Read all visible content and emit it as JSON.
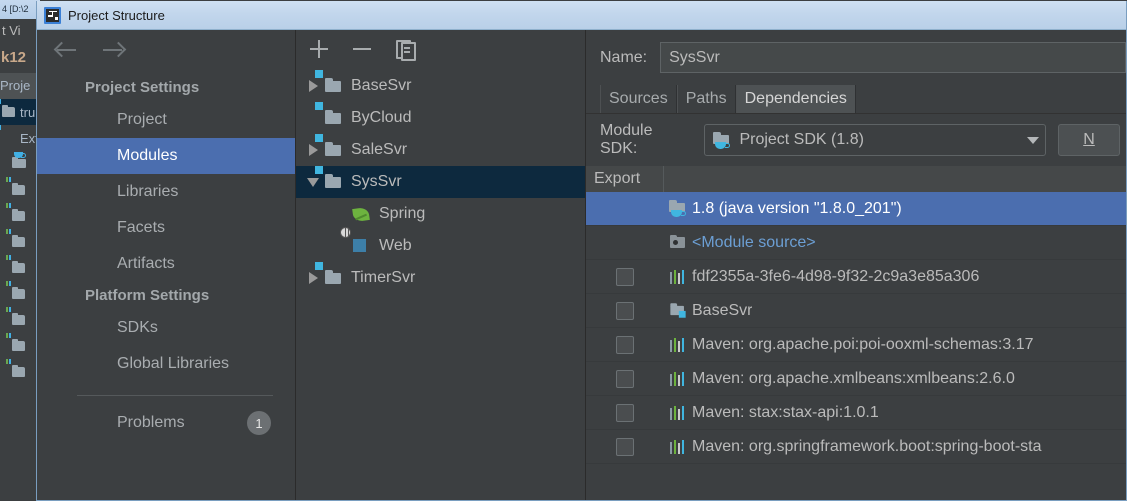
{
  "background_ide": {
    "titlebar": "4 [D:\\2",
    "menubar": "t  Vi",
    "toolbar": "k12",
    "tab": "Proje",
    "tree_rows": [
      {
        "label": "tru",
        "icon": "module-icon",
        "selected": true
      },
      {
        "label": "Ext",
        "icon": "library-icon",
        "selected": false
      },
      {
        "label": "",
        "icon": "sdk-folder-icon",
        "selected": false
      },
      {
        "label": "",
        "icon": "library-folder-icon",
        "selected": false
      },
      {
        "label": "",
        "icon": "library-folder-icon",
        "selected": false
      },
      {
        "label": "",
        "icon": "library-folder-icon",
        "selected": false
      },
      {
        "label": "",
        "icon": "library-folder-icon",
        "selected": false
      },
      {
        "label": "",
        "icon": "library-folder-icon",
        "selected": false
      },
      {
        "label": "",
        "icon": "library-folder-icon",
        "selected": false
      },
      {
        "label": "",
        "icon": "library-folder-icon",
        "selected": false
      },
      {
        "label": "",
        "icon": "library-folder-icon",
        "selected": false
      },
      {
        "label": "",
        "icon": "library-folder-icon",
        "selected": false
      }
    ]
  },
  "dialog": {
    "title": "Project Structure",
    "app_icon": "intellij-idea-logo-icon",
    "nav": {
      "back_icon": "arrow-left-icon",
      "forward_icon": "arrow-right-icon"
    },
    "sidebar": {
      "sections": [
        {
          "header": "Project Settings",
          "items": [
            {
              "label": "Project",
              "selected": false
            },
            {
              "label": "Modules",
              "selected": true
            },
            {
              "label": "Libraries",
              "selected": false
            },
            {
              "label": "Facets",
              "selected": false
            },
            {
              "label": "Artifacts",
              "selected": false
            }
          ]
        },
        {
          "header": "Platform Settings",
          "items": [
            {
              "label": "SDKs",
              "selected": false
            },
            {
              "label": "Global Libraries",
              "selected": false
            }
          ]
        }
      ],
      "problems": {
        "label": "Problems",
        "count": "1"
      }
    },
    "modules_panel": {
      "toolbar": {
        "add_icon": "plus-icon",
        "remove_icon": "minus-icon",
        "copy_icon": "copy-icon"
      },
      "tree": [
        {
          "label": "BaseSvr",
          "icon": "module-icon",
          "twisty": "right",
          "indent": 0,
          "selected": false
        },
        {
          "label": "ByCloud",
          "icon": "module-icon",
          "twisty": "none",
          "indent": 0,
          "selected": false
        },
        {
          "label": "SaleSvr",
          "icon": "module-icon",
          "twisty": "right",
          "indent": 0,
          "selected": false
        },
        {
          "label": "SysSvr",
          "icon": "module-icon",
          "twisty": "down",
          "indent": 0,
          "selected": true
        },
        {
          "label": "Spring",
          "icon": "spring-icon",
          "twisty": "none",
          "indent": 1,
          "selected": false
        },
        {
          "label": "Web",
          "icon": "web-icon",
          "twisty": "none",
          "indent": 1,
          "selected": false
        },
        {
          "label": "TimerSvr",
          "icon": "module-icon",
          "twisty": "right",
          "indent": 0,
          "selected": false
        }
      ]
    },
    "detail": {
      "name_label": "Name:",
      "name_value": "SysSvr",
      "tabs": [
        {
          "label": "Sources",
          "active": false
        },
        {
          "label": "Paths",
          "active": false
        },
        {
          "label": "Dependencies",
          "active": true
        }
      ],
      "module_sdk_label": "Module SDK:",
      "module_sdk_value": "Project SDK (1.8)",
      "module_sdk_icon": "sdk-folder-icon",
      "new_button_label": "N",
      "dependencies_header": [
        "Export"
      ],
      "dependencies": [
        {
          "label": "1.8 (java version \"1.8.0_201\")",
          "icon": "sdk-folder-icon",
          "checkbox": false,
          "selected": true,
          "link": false
        },
        {
          "label": "<Module source>",
          "icon": "module-source-icon",
          "checkbox": false,
          "selected": false,
          "link": true
        },
        {
          "label": "fdf2355a-3fe6-4d98-9f32-2c9a3e85a306",
          "icon": "library-icon",
          "checkbox": true,
          "checked": false,
          "selected": false,
          "link": false
        },
        {
          "label": "BaseSvr",
          "icon": "module-icon",
          "checkbox": true,
          "checked": false,
          "selected": false,
          "link": false
        },
        {
          "label": "Maven: org.apache.poi:poi-ooxml-schemas:3.17",
          "icon": "library-icon",
          "checkbox": true,
          "checked": false,
          "selected": false,
          "link": false
        },
        {
          "label": "Maven: org.apache.xmlbeans:xmlbeans:2.6.0",
          "icon": "library-icon",
          "checkbox": true,
          "checked": false,
          "selected": false,
          "link": false
        },
        {
          "label": "Maven: stax:stax-api:1.0.1",
          "icon": "library-icon",
          "checkbox": true,
          "checked": false,
          "selected": false,
          "link": false
        },
        {
          "label": "Maven: org.springframework.boot:spring-boot-sta",
          "icon": "library-icon",
          "checkbox": true,
          "checked": false,
          "selected": false,
          "link": false
        }
      ]
    }
  },
  "colors": {
    "accent_blue": "#4b6eaf",
    "tree_selection": "#0d293e",
    "panel_bg": "#3c3f41",
    "titlebar_top": "#cfe0f2",
    "link_blue": "#6c9fd4"
  }
}
